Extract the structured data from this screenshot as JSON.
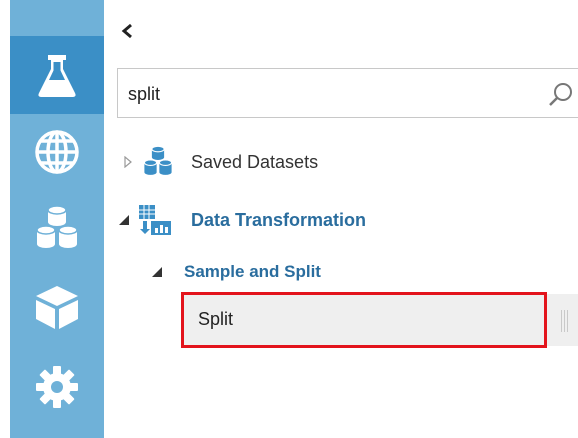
{
  "rail": {
    "items": [
      {
        "icon": "flask-icon",
        "active": true
      },
      {
        "icon": "globe-icon",
        "active": false
      },
      {
        "icon": "datasets-icon",
        "active": false
      },
      {
        "icon": "cube-icon",
        "active": false
      },
      {
        "icon": "gear-icon",
        "active": false
      }
    ]
  },
  "collapse": {
    "glyph": "‹"
  },
  "search": {
    "value": "split",
    "icon": "search-icon"
  },
  "tree": {
    "saved_datasets": {
      "label": "Saved Datasets",
      "expanded": false,
      "icon": "datasets-icon"
    },
    "data_transformation": {
      "label": "Data Transformation",
      "expanded": true,
      "icon": "data-transform-icon"
    },
    "sample_and_split": {
      "label": "Sample and Split",
      "expanded": true
    },
    "split": {
      "label": "Split",
      "highlighted": true
    }
  },
  "colors": {
    "rail_bg": "#6fb1d8",
    "rail_active": "#3b8fc6",
    "category_text": "#2a6d9e",
    "highlight_border": "#e3141c",
    "module_bg": "#efefef"
  }
}
